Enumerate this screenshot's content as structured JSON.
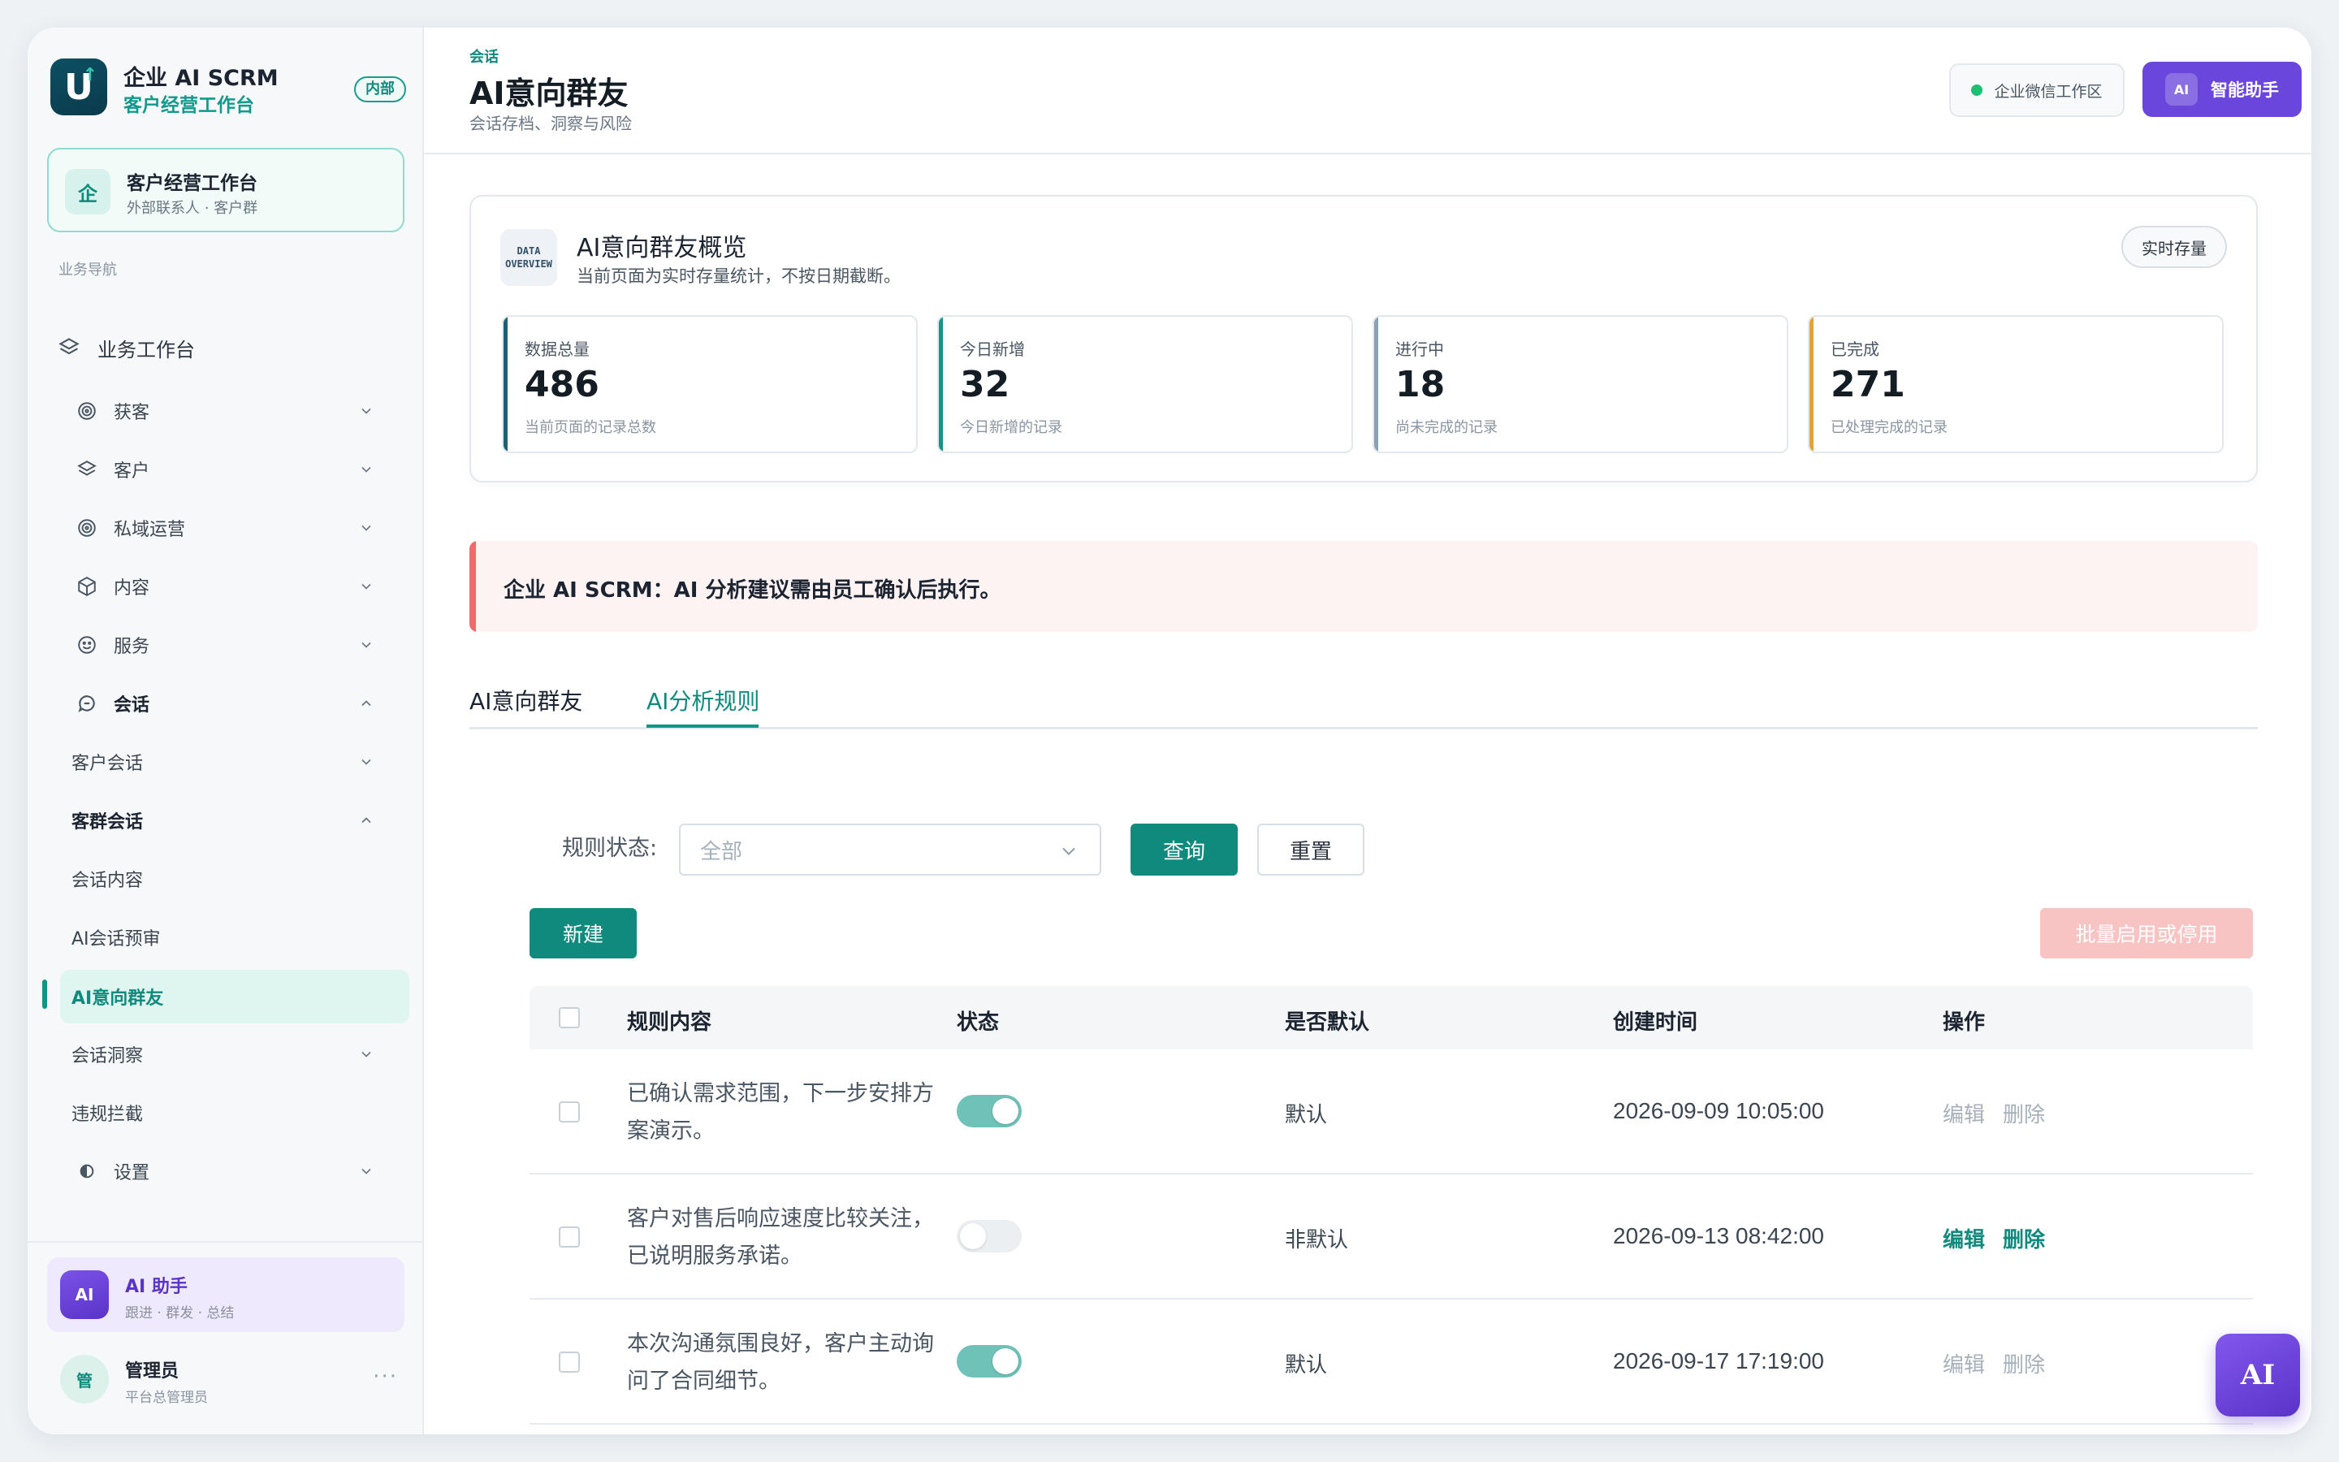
{
  "brand": {
    "logo": "U",
    "title": "企业 AI SCRM",
    "subtitle": "客户经营工作台",
    "badge": "内部"
  },
  "workspace": {
    "icon": "企",
    "title": "客户经营工作台",
    "subtitle": "外部联系人 · 客户群"
  },
  "nav": {
    "section": "业务导航",
    "items": [
      {
        "label": "业务工作台",
        "icon": "layers-icon"
      },
      {
        "label": "获客",
        "icon": "target-icon"
      },
      {
        "label": "客户",
        "icon": "layers-icon"
      },
      {
        "label": "私域运营",
        "icon": "target-icon"
      },
      {
        "label": "内容",
        "icon": "box-icon"
      },
      {
        "label": "服务",
        "icon": "smile-icon"
      },
      {
        "label": "会话",
        "icon": "chat-icon"
      },
      {
        "label": "客户会话"
      },
      {
        "label": "客群会话"
      },
      {
        "label": "会话内容"
      },
      {
        "label": "AI会话预审"
      },
      {
        "label": "AI意向群友"
      },
      {
        "label": "会话洞察"
      },
      {
        "label": "违规拦截"
      },
      {
        "label": "设置",
        "icon": "settings-icon"
      }
    ]
  },
  "assistant_card": {
    "avatar": "AI",
    "title": "AI 助手",
    "subtitle": "跟进 · 群发 · 总结"
  },
  "user": {
    "avatar": "管",
    "name": "管理员",
    "role": "平台总管理员",
    "more": "···"
  },
  "header": {
    "crumb": "会话",
    "title": "AI意向群友",
    "subtitle": "会话存档、洞察与风险",
    "workspace_pill": "企业微信工作区",
    "assistant_btn_icon": "AI",
    "assistant_btn": "智能助手"
  },
  "overview": {
    "icon_line1": "DATA",
    "icon_line2": "OVERVIEW",
    "title": "AI意向群友概览",
    "subtitle": "当前页面为实时存量统计，不按日期截断。",
    "pill": "实时存量",
    "stats": [
      {
        "label": "数据总量",
        "value": "486",
        "note": "当前页面的记录总数",
        "color": "#1f5e74"
      },
      {
        "label": "今日新增",
        "value": "32",
        "note": "今日新增的记录",
        "color": "#0f9686"
      },
      {
        "label": "进行中",
        "value": "18",
        "note": "尚未完成的记录",
        "color": "#8aa0b4"
      },
      {
        "label": "已完成",
        "value": "271",
        "note": "已处理完成的记录",
        "color": "#e2a23a"
      }
    ]
  },
  "notice": "企业 AI SCRM：AI 分析建议需由员工确认后执行。",
  "tabs": [
    {
      "label": "AI意向群友"
    },
    {
      "label": "AI分析规则"
    }
  ],
  "filter": {
    "label": "规则状态:",
    "placeholder": "全部",
    "query": "查询",
    "reset": "重置"
  },
  "actions": {
    "new": "新建",
    "batch": "批量启用或停用"
  },
  "table": {
    "columns": [
      "规则内容",
      "状态",
      "是否默认",
      "创建时间",
      "操作"
    ],
    "rows": [
      {
        "content": "已确认需求范围，下一步安排方案演示。",
        "enabled": true,
        "default": "默认",
        "created": "2026-09-09 10:05:00",
        "edit": "编辑",
        "delete": "删除"
      },
      {
        "content": "客户对售后响应速度比较关注，已说明服务承诺。",
        "enabled": false,
        "default": "非默认",
        "created": "2026-09-13 08:42:00",
        "edit": "编辑",
        "delete": "删除"
      },
      {
        "content": "本次沟通氛围良好，客户主动询问了合同细节。",
        "enabled": true,
        "default": "默认",
        "created": "2026-09-17 17:19:00",
        "edit": "编辑",
        "delete": "删除"
      }
    ]
  },
  "fab": "AI"
}
